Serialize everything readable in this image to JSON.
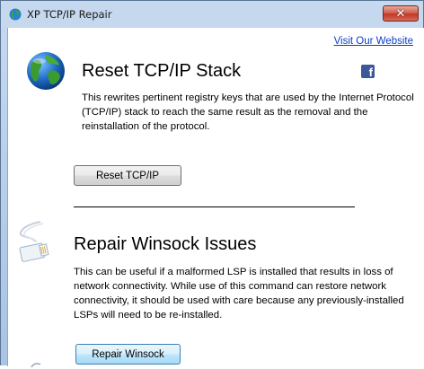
{
  "window": {
    "title": "XP TCP/IP Repair",
    "close_glyph": "✕"
  },
  "header": {
    "visit_link": "Visit Our Website",
    "facebook_glyph": "f"
  },
  "sections": [
    {
      "icon": "globe-icon",
      "title": "Reset TCP/IP Stack",
      "description": "This rewrites pertinent registry keys that are used by the Internet Protocol (TCP/IP) stack to reach the same result as the removal and the reinstallation of the protocol.",
      "button_label": "Reset TCP/IP"
    },
    {
      "icon": "network-cable-icon",
      "title": "Repair Winsock Issues",
      "description": "This can be useful if a malformed LSP is installed that results in loss of network connectivity. While use of this command can restore network connectivity, it should be used with care because any previously-installed LSPs will need to be re-installed.",
      "button_label": "Repair Winsock"
    }
  ],
  "colors": {
    "link": "#0b3fc7",
    "facebook": "#3b5998",
    "titlebar": "#c7d9ef",
    "close_button": "#c0392b"
  }
}
